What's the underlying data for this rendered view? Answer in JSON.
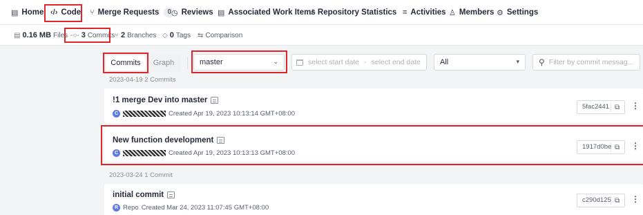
{
  "top_nav": {
    "home": "Home",
    "code": "Code",
    "merge_requests": "Merge Requests",
    "merge_requests_count": "0",
    "reviews": "Reviews",
    "associated_work_items": "Associated Work Items",
    "repository_statistics": "Repository Statistics",
    "activities": "Activities",
    "members": "Members",
    "settings": "Settings"
  },
  "sub_nav": {
    "files_size": "0.16 MB",
    "files_label": "Files",
    "commits_count": "3",
    "commits_label": "Commits",
    "branches_count": "2",
    "branches_label": "Branches",
    "tags_count": "0",
    "tags_label": "Tags",
    "comparison": "Comparison"
  },
  "toolbar": {
    "commits_tab": "Commits",
    "graph_tab": "Graph",
    "branch_value": "master",
    "start_date_placeholder": "select start date",
    "date_separator": "-",
    "end_date_placeholder": "select end date",
    "author_value": "All",
    "filter_placeholder": "Filter by commit messag..."
  },
  "groups": [
    {
      "date_label": "2023-04-19  2 Commits",
      "commits": [
        {
          "title": "!1  merge Dev into master",
          "avatar": "C",
          "created": "Created Apr 19, 2023 10:13:14 GMT+08:00",
          "hash": "5fac2441"
        },
        {
          "title": "New function development",
          "avatar": "C",
          "created": "Created Apr 19, 2023 10:13:13 GMT+08:00",
          "hash": "1917d0be"
        }
      ]
    },
    {
      "date_label": "2023-03-24  1 Commit",
      "commits": [
        {
          "title": "initial commit",
          "avatar": "R",
          "author": "Repo",
          "created": "Created Mar 24, 2023 11:07:45 GMT+08:00",
          "hash": "c290d125"
        }
      ]
    }
  ],
  "colors": {
    "highlight": "#e0242a",
    "avatar": "#5e7ce0"
  }
}
